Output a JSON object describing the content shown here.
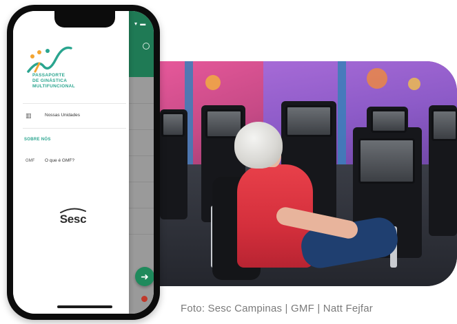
{
  "photo": {
    "credit": "Foto: Sesc Campinas | GMF | Natt Fejfar"
  },
  "app": {
    "logo_lines": [
      "PASSAPORTE",
      "DE GINÁSTICA",
      "MULTIFUNCIONAL"
    ],
    "menu": [
      {
        "icon": "home-icon",
        "label": "Nossas Unidades"
      },
      {
        "icon": "info-icon",
        "label": "O que é GMF?"
      }
    ],
    "section_title": "SOBRE NÓS",
    "brand": "Sesc",
    "fab_icon": "arrow-right-icon",
    "colors": {
      "primary_green": "#1f7a55",
      "accent_teal": "#2aa58f",
      "logo_orange": "#f3a531"
    }
  }
}
